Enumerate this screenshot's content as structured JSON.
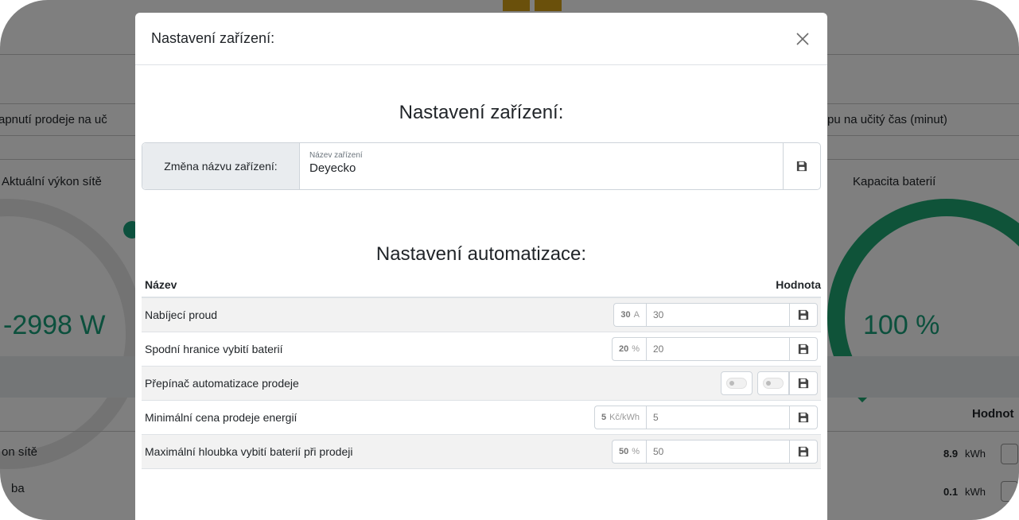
{
  "background": {
    "left_heading_1": "apnutí prodeje na uč",
    "right_heading_1": "pu na učitý čas (minut)",
    "left_heading_2": "Aktuální výkon sítě",
    "right_heading_2": "Kapacita baterií",
    "left_big_value": "-2998 W",
    "right_big_value": "100 %",
    "table_header_right": "Hodnot",
    "row1_label": "on sítě",
    "row1_value": "8.9",
    "row1_unit": "kWh",
    "row2_label": "ba",
    "row2_value": "0.1",
    "row2_unit": "kWh",
    "accent_color": "#19a07a"
  },
  "modal": {
    "header_title": "Nastavení zařízení:",
    "close_icon": "close-icon",
    "device_section_title": "Nastavení zařízení:",
    "rename": {
      "label": "Změna názvu zařízení:",
      "field_label": "Název zařízení",
      "field_value": "Deyecko",
      "save_icon": "floppy-disk-icon"
    },
    "automation_section_title": "Nastavení automatizace:",
    "table": {
      "col_name": "Název",
      "col_value": "Hodnota",
      "rows": [
        {
          "label": "Nabíjecí proud",
          "current": "30",
          "unit": "A",
          "input": "30"
        },
        {
          "label": "Spodní hranice vybití baterií",
          "current": "20",
          "unit": "%",
          "input": "20"
        },
        {
          "label": "Přepínač automatizace prodeje"
        },
        {
          "label": "Minimální cena prodeje energií",
          "current": "5",
          "unit": "Kč/kWh",
          "input": "5"
        },
        {
          "label": "Maximální hloubka vybití baterií při prodeji",
          "current": "50",
          "unit": "%",
          "input": "50"
        }
      ]
    }
  }
}
